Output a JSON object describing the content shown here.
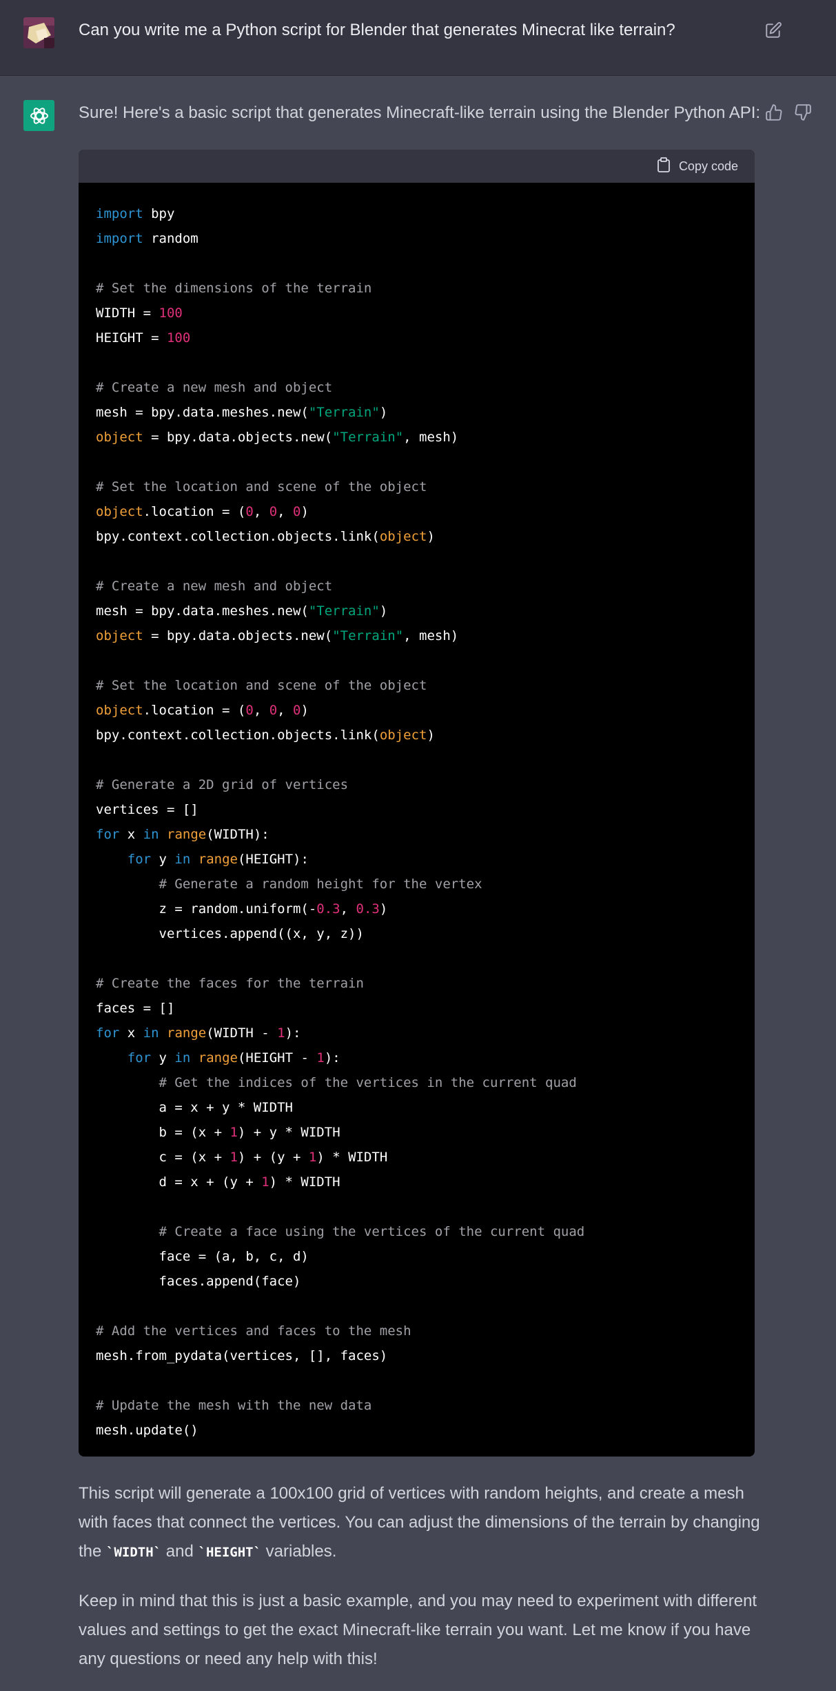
{
  "user": {
    "message": "Can you write me a Python script for Blender that generates Minecrat like terrain?"
  },
  "assistant": {
    "intro": "Sure! Here's a basic script that generates Minecraft-like terrain using the Blender Python API:",
    "copy_label": "Copy code",
    "code_lines": [
      "import bpy",
      "import random",
      "",
      "# Set the dimensions of the terrain",
      "WIDTH = 100",
      "HEIGHT = 100",
      "",
      "# Create a new mesh and object",
      "mesh = bpy.data.meshes.new(\"Terrain\")",
      "object = bpy.data.objects.new(\"Terrain\", mesh)",
      "",
      "# Set the location and scene of the object",
      "object.location = (0, 0, 0)",
      "bpy.context.collection.objects.link(object)",
      "",
      "# Create a new mesh and object",
      "mesh = bpy.data.meshes.new(\"Terrain\")",
      "object = bpy.data.objects.new(\"Terrain\", mesh)",
      "",
      "# Set the location and scene of the object",
      "object.location = (0, 0, 0)",
      "bpy.context.collection.objects.link(object)",
      "",
      "# Generate a 2D grid of vertices",
      "vertices = []",
      "for x in range(WIDTH):",
      "    for y in range(HEIGHT):",
      "        # Generate a random height for the vertex",
      "        z = random.uniform(-0.3, 0.3)",
      "        vertices.append((x, y, z))",
      "",
      "# Create the faces for the terrain",
      "faces = []",
      "for x in range(WIDTH - 1):",
      "    for y in range(HEIGHT - 1):",
      "        # Get the indices of the vertices in the current quad",
      "        a = x + y * WIDTH",
      "        b = (x + 1) + y * WIDTH",
      "        c = (x + 1) + (y + 1) * WIDTH",
      "        d = x + (y + 1) * WIDTH",
      "",
      "        # Create a face using the vertices of the current quad",
      "        face = (a, b, c, d)",
      "        faces.append(face)",
      "",
      "# Add the vertices and faces to the mesh",
      "mesh.from_pydata(vertices, [], faces)",
      "",
      "# Update the mesh with the new data",
      "mesh.update()"
    ],
    "para1": {
      "before": "This script will generate a 100x100 grid of vertices with random heights, and create a mesh with faces that connect the vertices. You can adjust the dimensions of the terrain by changing the ",
      "code1": "`WIDTH`",
      "middle": " and ",
      "code2": "`HEIGHT`",
      "after": " variables."
    },
    "para2": "Keep in mind that this is just a basic example, and you may need to experiment with different values and settings to get the exact Minecraft-like terrain you want. Let me know if you have any questions or need any help with this!"
  },
  "colors": {
    "user_bg": "#343541",
    "assistant_bg": "#444654",
    "code_bg": "#000000",
    "brand": "#10a37f",
    "keyword": "#2e95d3",
    "comment": "#a0a0a6",
    "number": "#df3079",
    "string": "#00a67d",
    "builtin": "#f0a038"
  },
  "icons": [
    "user-avatar",
    "edit-icon",
    "openai-logo-icon",
    "thumbs-up-icon",
    "thumbs-down-icon",
    "clipboard-icon"
  ]
}
